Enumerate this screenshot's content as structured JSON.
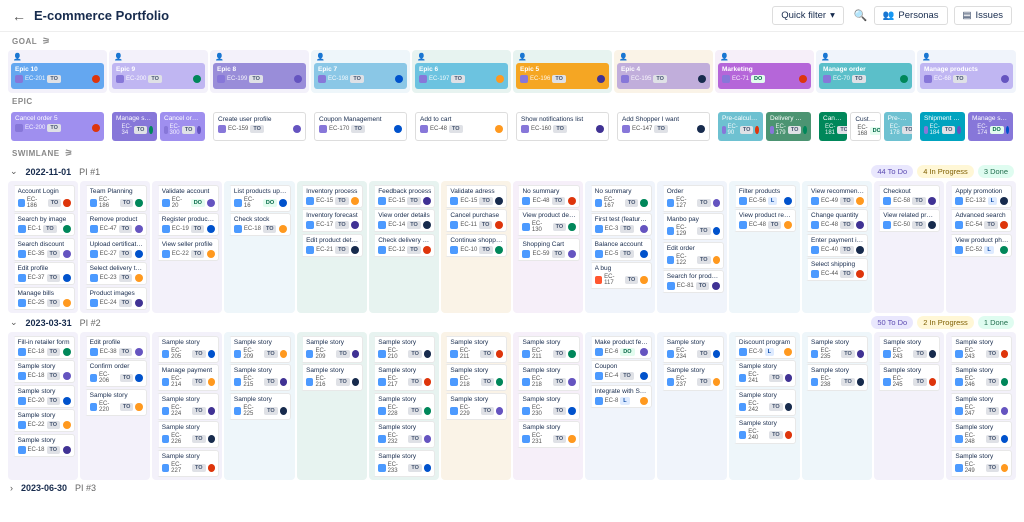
{
  "header": {
    "title": "E-commerce Portfolio",
    "quick_filter": "Quick filter",
    "personas": "Personas",
    "issues": "Issues"
  },
  "labels": {
    "goal": "GOAL",
    "epic": "EPIC",
    "swimlane": "SWIMLANE"
  },
  "columns": [
    {
      "goal": {
        "title": "Epic 10",
        "key": "EC-201",
        "bg": "#64A7F0",
        "status": "TO"
      },
      "epics": [
        {
          "title": "Cancel order 5",
          "key": "EC-200",
          "bg": "#9F8FEF",
          "status": "TO"
        }
      ]
    },
    {
      "goal": {
        "title": "Epic 9",
        "key": "EC-200",
        "bg": "#C0B6F2",
        "status": "TO"
      },
      "epics": [
        {
          "title": "Manage shipping",
          "key": "EC-34",
          "bg": "#8777D9",
          "status": "TO"
        },
        {
          "title": "Cancel order 2",
          "key": "EC-300",
          "bg": "#9F8FEF",
          "status": "TO"
        }
      ]
    },
    {
      "goal": {
        "title": "Epic 8",
        "key": "EC-199",
        "bg": "#998DD9",
        "status": "TO"
      },
      "epics": [
        {
          "title": "Create user profile",
          "key": "EC-159",
          "bg": "#FFFFFF",
          "status": "TO",
          "light": true
        }
      ]
    },
    {
      "goal": {
        "title": "Epic 7",
        "key": "EC-198",
        "bg": "#8AC7E6",
        "status": "TO"
      },
      "epics": [
        {
          "title": "Coupon Management",
          "key": "EC-170",
          "bg": "#FFFFFF",
          "status": "TO",
          "light": true
        }
      ]
    },
    {
      "goal": {
        "title": "Epic 6",
        "key": "EC-197",
        "bg": "#6CC3E0",
        "status": "TO"
      },
      "epics": [
        {
          "title": "Add to cart",
          "key": "EC-48",
          "bg": "#FFFFFF",
          "status": "TO",
          "light": true
        }
      ]
    },
    {
      "goal": {
        "title": "Epic 5",
        "key": "EC-196",
        "bg": "#F5A623",
        "status": "TO"
      },
      "epics": [
        {
          "title": "Show notifications list",
          "key": "EC-160",
          "bg": "#FFFFFF",
          "status": "TO",
          "light": true
        }
      ]
    },
    {
      "goal": {
        "title": "Epic 4",
        "key": "EC-195",
        "bg": "#C1AEDB",
        "status": "TO"
      },
      "epics": [
        {
          "title": "Add Shopper I want",
          "key": "EC-147",
          "bg": "#FFFFFF",
          "status": "TO",
          "light": true
        }
      ]
    },
    {
      "goal": {
        "title": "Marketing",
        "key": "EC-71",
        "bg": "#B566D9",
        "status": "DO"
      },
      "epics": [
        {
          "title": "Pre-calculation",
          "key": "EC-90",
          "bg": "#6EC1D1",
          "status": "TO"
        },
        {
          "title": "Delivery Management",
          "key": "EC-179",
          "bg": "#4C9472",
          "status": "TO"
        }
      ]
    },
    {
      "goal": {
        "title": "Manage order",
        "key": "EC-70",
        "bg": "#5BBFC9",
        "status": "TO"
      },
      "epics": [
        {
          "title": "Cancel order",
          "key": "EC-181",
          "bg": "#00875A",
          "status": "TO"
        },
        {
          "title": "Customer Relationship",
          "key": "EC-168",
          "bg": "#FFFFFF",
          "status": "DO",
          "light": true
        },
        {
          "title": "Pre-call phone SLA",
          "key": "EC-178",
          "bg": "#6EC1D1",
          "status": "TO"
        }
      ]
    },
    {
      "goal": {
        "title": "Manage products",
        "key": "EC-68",
        "bg": "#C0B6F2",
        "status": "TO"
      },
      "epics": [
        {
          "title": "Shipment management",
          "key": "EC-184",
          "bg": "#00A3BF",
          "status": "TO"
        },
        {
          "title": "Manage shipment",
          "key": "EC-174",
          "bg": "#8777D9",
          "status": "DO"
        }
      ]
    }
  ],
  "swimlanes": [
    {
      "date": "2022-11-01",
      "name": "PI #1",
      "open": true,
      "counts": {
        "todo": "44 To Do",
        "prog": "4 In Progress",
        "done": "3 Done"
      },
      "rows": [
        [
          {
            "t": "Account Login",
            "k": "EC-186",
            "s": "TO",
            "i": "task"
          },
          {
            "t": "Search by image",
            "k": "EC-1",
            "s": "TO",
            "i": "task"
          },
          {
            "t": "Search discount",
            "k": "EC-35",
            "s": "TO",
            "i": "task"
          },
          {
            "t": "Edit profile",
            "k": "EC-37",
            "s": "TO",
            "i": "task"
          },
          {
            "t": "Manage bills",
            "k": "EC-25",
            "s": "TO",
            "i": "task"
          }
        ],
        [
          {
            "t": "Team Planning",
            "k": "EC-186",
            "s": "TO",
            "i": "task"
          },
          {
            "t": "Remove product",
            "k": "EC-47",
            "s": "TO",
            "i": "task"
          },
          {
            "t": "Upload certificates",
            "k": "EC-27",
            "s": "TO",
            "i": "task"
          },
          {
            "t": "Select delivery time",
            "k": "EC-23",
            "s": "TO",
            "i": "task"
          },
          {
            "t": "Product images",
            "k": "EC-24",
            "s": "TO",
            "i": "task"
          }
        ],
        [
          {
            "t": "Validate account",
            "k": "EC-20",
            "s": "DO",
            "i": "task"
          },
          {
            "t": "Register product info",
            "k": "EC-19",
            "s": "TO",
            "i": "task"
          },
          {
            "t": "View seller profile",
            "k": "EC-22",
            "s": "TO",
            "i": "task"
          }
        ],
        [
          {
            "t": "List products updated",
            "k": "EC-16",
            "s": "DO",
            "i": "task"
          },
          {
            "t": "Check stock",
            "k": "EC-18",
            "s": "TO",
            "i": "task"
          }
        ],
        [
          {
            "t": "Inventory process",
            "k": "EC-15",
            "s": "TO",
            "i": "task"
          },
          {
            "t": "Inventory forecast",
            "k": "EC-17",
            "s": "TO",
            "i": "task"
          },
          {
            "t": "Edit product details",
            "k": "EC-21",
            "s": "TO",
            "i": "task"
          }
        ],
        [
          {
            "t": "Feedback process",
            "k": "EC-15",
            "s": "TO",
            "i": "task"
          },
          {
            "t": "View order details",
            "k": "EC-14",
            "s": "TO",
            "i": "task"
          },
          {
            "t": "Check delivery status",
            "k": "EC-12",
            "s": "TO",
            "i": "task"
          }
        ],
        [
          {
            "t": "Validate adress",
            "k": "EC-15",
            "s": "TO",
            "i": "task"
          },
          {
            "t": "Cancel purchase",
            "k": "EC-11",
            "s": "TO",
            "i": "task"
          },
          {
            "t": "Continue shopping",
            "k": "EC-10",
            "s": "TO",
            "i": "task"
          }
        ],
        [
          {
            "t": "No summary",
            "k": "EC-48",
            "s": "TO",
            "i": "task"
          },
          {
            "t": "View product details",
            "k": "EC-130",
            "s": "TO",
            "i": "task"
          },
          {
            "t": "Shopping Cart",
            "k": "EC-59",
            "s": "TO",
            "i": "task"
          }
        ],
        [
          {
            "t": "No summary",
            "k": "EC-167",
            "s": "TO",
            "i": "task"
          },
          {
            "t": "First test (feature 1)",
            "k": "EC-3",
            "s": "TO",
            "i": "task"
          },
          {
            "t": "Balance account",
            "k": "EC-5",
            "s": "TO",
            "i": "task"
          },
          {
            "t": "A bug",
            "k": "EC-117",
            "s": "TO",
            "i": "bug"
          }
        ],
        [
          {
            "t": "Order",
            "k": "EC-127",
            "s": "TO",
            "i": "task"
          },
          {
            "t": "Manbo pay",
            "k": "EC-129",
            "s": "TO",
            "i": "task"
          },
          {
            "t": "Edit order",
            "k": "EC-122",
            "s": "TO",
            "i": "task"
          },
          {
            "t": "Search for product",
            "k": "EC-81",
            "s": "TO",
            "i": "task"
          }
        ],
        [
          {
            "t": "Filter products",
            "k": "EC-56",
            "s": "L",
            "i": "task"
          },
          {
            "t": "View product reviews",
            "k": "EC-48",
            "s": "TO",
            "i": "task"
          }
        ],
        [
          {
            "t": "View recommended",
            "k": "EC-49",
            "s": "TO",
            "i": "task"
          },
          {
            "t": "Change quantity",
            "k": "EC-48",
            "s": "TO",
            "i": "task"
          },
          {
            "t": "Enter payment info",
            "k": "EC-40",
            "s": "TO",
            "i": "task"
          },
          {
            "t": "Select shipping",
            "k": "EC-44",
            "s": "TO",
            "i": "task"
          }
        ],
        [
          {
            "t": "Checkout",
            "k": "EC-58",
            "s": "TO",
            "i": "task"
          },
          {
            "t": "View related products",
            "k": "EC-50",
            "s": "TO",
            "i": "task"
          }
        ],
        [
          {
            "t": "Apply promotion",
            "k": "EC-132",
            "s": "L",
            "i": "task"
          },
          {
            "t": "Advanced search",
            "k": "EC-54",
            "s": "TO",
            "i": "task"
          },
          {
            "t": "View product photos",
            "k": "EC-52",
            "s": "L",
            "i": "task"
          }
        ]
      ]
    },
    {
      "date": "2023-03-31",
      "name": "PI #2",
      "open": true,
      "counts": {
        "todo": "50 To Do",
        "prog": "2 In Progress",
        "done": "1 Done"
      },
      "rows": [
        [
          {
            "t": "Fill-in retailer form",
            "k": "EC-18",
            "s": "TO",
            "i": "task"
          },
          {
            "t": "Sample story",
            "k": "EC-18",
            "s": "TO",
            "i": "task"
          },
          {
            "t": "Sample story",
            "k": "EC-20",
            "s": "TO",
            "i": "task"
          },
          {
            "t": "Sample story",
            "k": "EC-22",
            "s": "TO",
            "i": "task"
          },
          {
            "t": "Sample story",
            "k": "EC-18",
            "s": "TO",
            "i": "task"
          }
        ],
        [
          {
            "t": "Edit profile",
            "k": "EC-38",
            "s": "TO",
            "i": "task"
          },
          {
            "t": "Confirm order",
            "k": "EC-206",
            "s": "TO",
            "i": "task"
          },
          {
            "t": "Sample story",
            "k": "EC-220",
            "s": "TO",
            "i": "task"
          }
        ],
        [
          {
            "t": "Sample story",
            "k": "EC-205",
            "s": "TO",
            "i": "task"
          },
          {
            "t": "Manage payment",
            "k": "EC-214",
            "s": "TO",
            "i": "task"
          },
          {
            "t": "Sample story",
            "k": "EC-224",
            "s": "TO",
            "i": "task"
          },
          {
            "t": "Sample story",
            "k": "EC-226",
            "s": "TO",
            "i": "task"
          },
          {
            "t": "Sample story",
            "k": "EC-227",
            "s": "TO",
            "i": "task"
          }
        ],
        [
          {
            "t": "Sample story",
            "k": "EC-209",
            "s": "TO",
            "i": "task"
          },
          {
            "t": "Sample story",
            "k": "EC-215",
            "s": "TO",
            "i": "task"
          },
          {
            "t": "Sample story",
            "k": "EC-225",
            "s": "TO",
            "i": "task"
          }
        ],
        [
          {
            "t": "Sample story",
            "k": "EC-209",
            "s": "TO",
            "i": "task"
          },
          {
            "t": "Sample story",
            "k": "EC-216",
            "s": "TO",
            "i": "task"
          }
        ],
        [
          {
            "t": "Sample story",
            "k": "EC-210",
            "s": "TO",
            "i": "task"
          },
          {
            "t": "Sample story",
            "k": "EC-217",
            "s": "TO",
            "i": "task"
          },
          {
            "t": "Sample story",
            "k": "EC-228",
            "s": "TO",
            "i": "task"
          },
          {
            "t": "Sample story",
            "k": "EC-232",
            "s": "TO",
            "i": "task"
          },
          {
            "t": "Sample story",
            "k": "EC-233",
            "s": "TO",
            "i": "task"
          }
        ],
        [
          {
            "t": "Sample story",
            "k": "EC-211",
            "s": "TO",
            "i": "task"
          },
          {
            "t": "Sample story",
            "k": "EC-218",
            "s": "TO",
            "i": "task"
          },
          {
            "t": "Sample story",
            "k": "EC-229",
            "s": "TO",
            "i": "task"
          }
        ],
        [
          {
            "t": "Sample story",
            "k": "EC-211",
            "s": "TO",
            "i": "task"
          },
          {
            "t": "Sample story",
            "k": "EC-218",
            "s": "TO",
            "i": "task"
          },
          {
            "t": "Sample story",
            "k": "EC-230",
            "s": "TO",
            "i": "task"
          },
          {
            "t": "Sample story",
            "k": "EC-231",
            "s": "TO",
            "i": "task"
          }
        ],
        [
          {
            "t": "Make product featured",
            "k": "EC-6",
            "s": "DO",
            "i": "task"
          },
          {
            "t": "Coupon",
            "k": "EC-4",
            "s": "TO",
            "i": "task"
          },
          {
            "t": "Integrate with SNS",
            "k": "EC-8",
            "s": "L",
            "i": "task"
          }
        ],
        [
          {
            "t": "Sample story",
            "k": "EC-234",
            "s": "TO",
            "i": "task"
          },
          {
            "t": "Sample story",
            "k": "EC-237",
            "s": "TO",
            "i": "task"
          }
        ],
        [
          {
            "t": "Discount program",
            "k": "EC-9",
            "s": "L",
            "i": "task"
          },
          {
            "t": "Sample story",
            "k": "EC-241",
            "s": "TO",
            "i": "task"
          },
          {
            "t": "Sample story",
            "k": "EC-242",
            "s": "TO",
            "i": "task"
          },
          {
            "t": "Sample story",
            "k": "EC-240",
            "s": "TO",
            "i": "task"
          }
        ],
        [
          {
            "t": "Sample story",
            "k": "EC-235",
            "s": "TO",
            "i": "task"
          },
          {
            "t": "Sample story",
            "k": "EC-238",
            "s": "TO",
            "i": "task"
          }
        ],
        [
          {
            "t": "Sample story",
            "k": "EC-243",
            "s": "TO",
            "i": "task"
          },
          {
            "t": "Sample story",
            "k": "EC-245",
            "s": "TO",
            "i": "task"
          }
        ],
        [
          {
            "t": "Sample story",
            "k": "EC-243",
            "s": "TO",
            "i": "task"
          },
          {
            "t": "Sample story",
            "k": "EC-246",
            "s": "TO",
            "i": "task"
          },
          {
            "t": "Sample story",
            "k": "EC-247",
            "s": "TO",
            "i": "task"
          },
          {
            "t": "Sample story",
            "k": "EC-248",
            "s": "TO",
            "i": "task"
          },
          {
            "t": "Sample story",
            "k": "EC-249",
            "s": "TO",
            "i": "task"
          }
        ]
      ]
    },
    {
      "date": "2023-06-30",
      "name": "PI #3",
      "open": false
    }
  ],
  "col_tints": [
    "#F3F1FA",
    "#F3F1FA",
    "#F3F1FA",
    "#EEF6FA",
    "#E7F3F0",
    "#E7F3F0",
    "#FAF3E7",
    "#F6EFF9",
    "#F0F4FB",
    "#F0F4FB",
    "#EEF6FA",
    "#EEF6FA",
    "#F3F1FA",
    "#F3F1FA"
  ],
  "avatars": [
    "#DE350B",
    "#00875A",
    "#6554C0",
    "#0052CC",
    "#FF991F",
    "#403294",
    "#172B4D"
  ]
}
